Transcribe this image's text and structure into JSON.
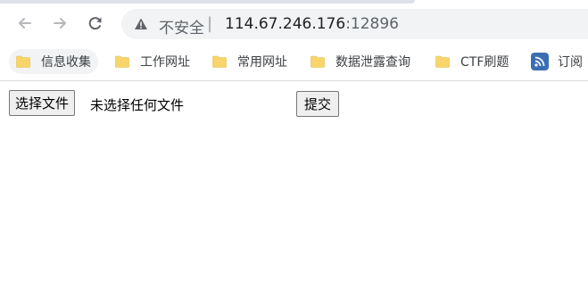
{
  "browser": {
    "security_label": "不安全",
    "separator": "|",
    "url_host": "114.67.246.176",
    "url_port": ":12896",
    "icons": {
      "back": "arrow-left-icon",
      "forward": "arrow-right-icon",
      "reload": "reload-icon",
      "security": "warning-triangle-icon"
    }
  },
  "bookmarks": [
    {
      "label": "信息收集",
      "icon": "folder-icon",
      "active": true
    },
    {
      "label": "工作网址",
      "icon": "folder-icon"
    },
    {
      "label": "常用网址",
      "icon": "folder-icon"
    },
    {
      "label": "数据泄露查询",
      "icon": "folder-icon"
    },
    {
      "label": "CTF刷题",
      "icon": "folder-icon"
    },
    {
      "label": "订阅",
      "icon": "rss-icon"
    }
  ],
  "form": {
    "choose_file_label": "选择文件",
    "file_status": "未选择任何文件",
    "submit_label": "提交"
  },
  "colors": {
    "folder": "#f7d56b",
    "rss": "#3b6db3",
    "omnibox_bg": "#f1f3f4"
  }
}
